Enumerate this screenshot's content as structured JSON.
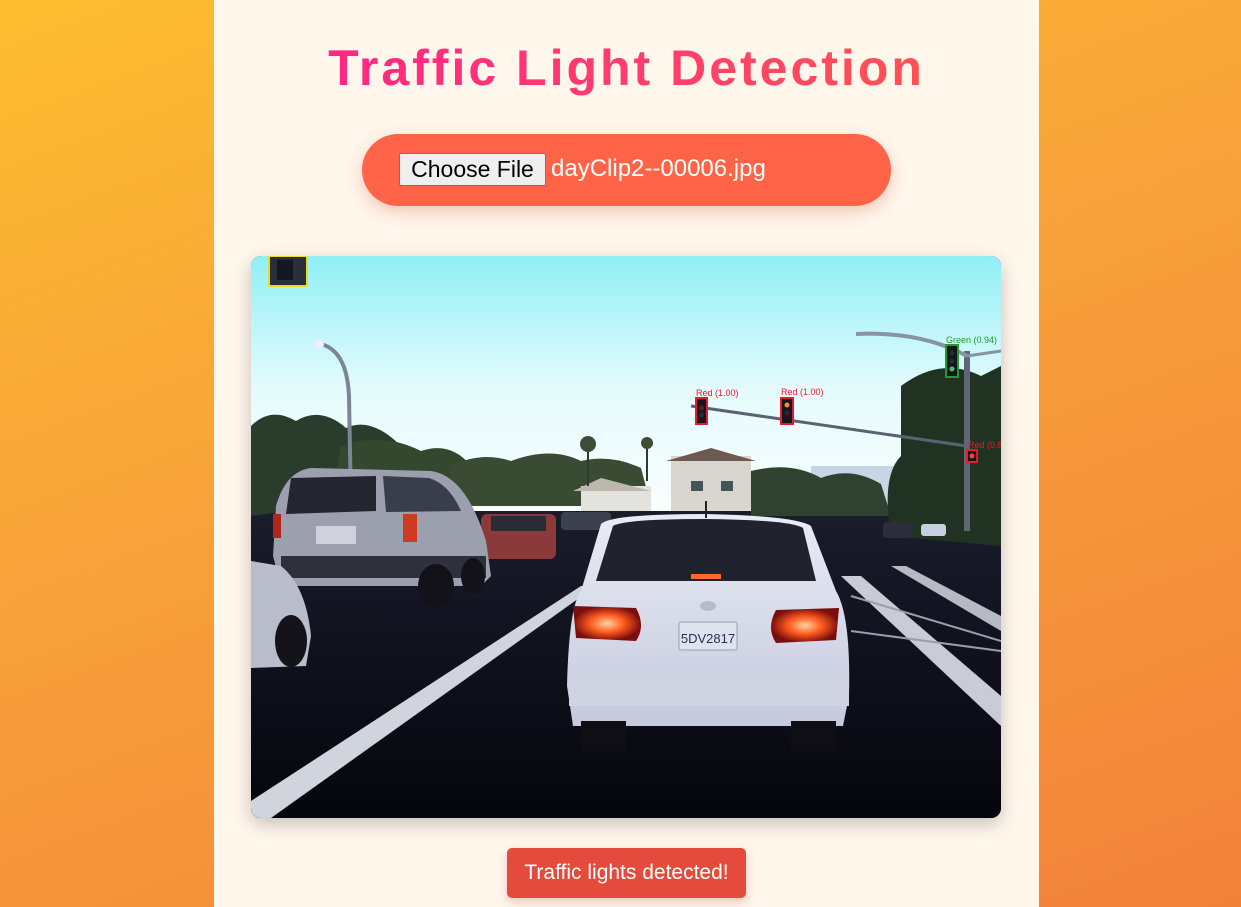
{
  "page": {
    "title": "Traffic Light Detection"
  },
  "upload": {
    "button_label": "Choose File",
    "file_name": "dayClip2--00006.jpg"
  },
  "detections": [
    {
      "label": "Red (1.00)",
      "color": "#e8192c"
    },
    {
      "label": "Red (1.00)",
      "color": "#e8192c"
    },
    {
      "label": "Green (0.94)",
      "color": "#1e9a2e"
    },
    {
      "label": "Red (0.8",
      "color": "#e8192c"
    }
  ],
  "plate_text": "5DV2817",
  "status": {
    "message": "Traffic lights detected!"
  },
  "colors": {
    "panel_bg": "#fff6ec",
    "accent": "#ff6448",
    "status_bg": "#e54b3c",
    "title_start": "#ff1e8c",
    "title_end": "#ff5a4a"
  }
}
